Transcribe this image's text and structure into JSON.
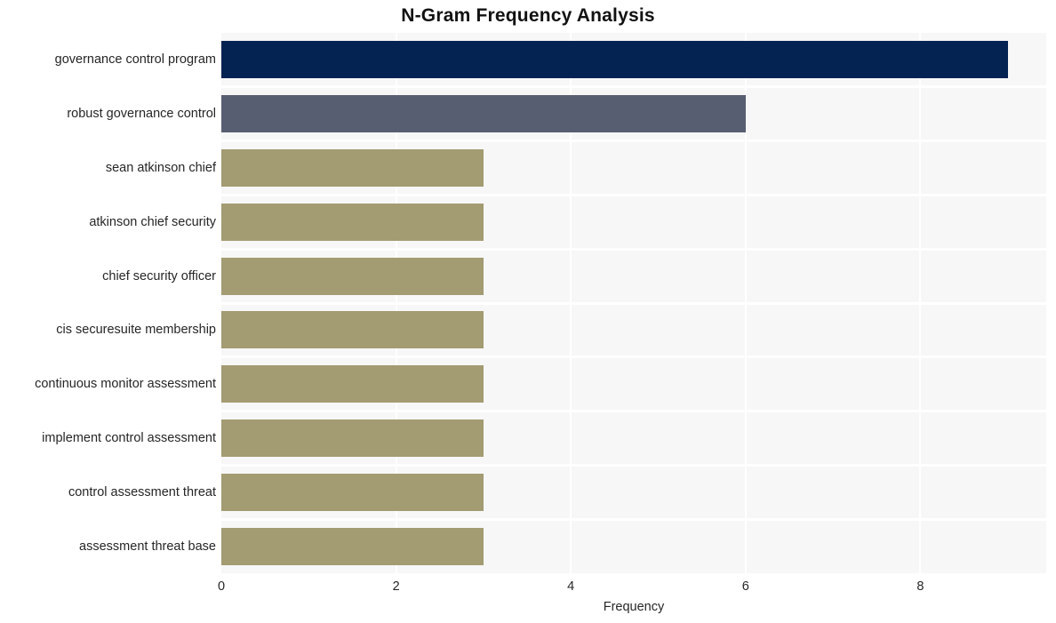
{
  "chart_data": {
    "type": "bar",
    "orientation": "horizontal",
    "title": "N-Gram Frequency Analysis",
    "xlabel": "Frequency",
    "ylabel": "",
    "categories": [
      "governance control program",
      "robust governance control",
      "sean atkinson chief",
      "atkinson chief security",
      "chief security officer",
      "cis securesuite membership",
      "continuous monitor assessment",
      "implement control assessment",
      "control assessment threat",
      "assessment threat base"
    ],
    "values": [
      9,
      6,
      3,
      3,
      3,
      3,
      3,
      3,
      3,
      3
    ],
    "bar_colors": [
      "#042252",
      "#585e72",
      "#a39b72",
      "#a39b72",
      "#a39b72",
      "#a39b72",
      "#a39b72",
      "#a39b72",
      "#a39b72",
      "#a39b72"
    ],
    "xlim": [
      0,
      9.44
    ],
    "xticks": [
      0,
      2,
      4,
      6,
      8
    ],
    "xtick_labels": [
      "0",
      "2",
      "4",
      "6",
      "8"
    ],
    "grid": true,
    "grid_color": "#ffffff",
    "plot_background": "#f7f7f7",
    "figure_background": "#ffffff",
    "legend": null
  }
}
